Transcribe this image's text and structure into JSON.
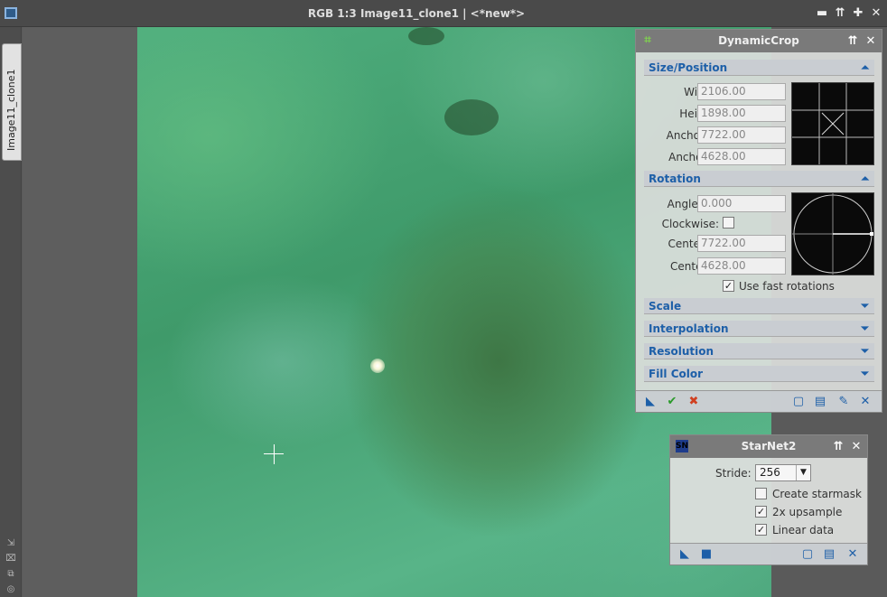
{
  "window": {
    "title": "RGB 1:3 Image11_clone1 | <*new*>",
    "buttons": [
      "▬",
      "⇈",
      "✚",
      "✕"
    ]
  },
  "side_tab": {
    "label": "Image11_clone1"
  },
  "side_icons": [
    "⇲",
    "⌧",
    "⧉",
    "◎"
  ],
  "dynamic_crop": {
    "title": "DynamicCrop",
    "size_position": {
      "header": "Size/Position",
      "fields": [
        {
          "label": "Width:",
          "value": "2106.00"
        },
        {
          "label": "Height:",
          "value": "1898.00"
        },
        {
          "label": "Anchor X:",
          "value": "7722.00"
        },
        {
          "label": "Anchor Y:",
          "value": "4628.00"
        }
      ]
    },
    "rotation": {
      "header": "Rotation",
      "angle_label": "Angle (°):",
      "angle_value": "0.000",
      "clockwise_label": "Clockwise:",
      "clockwise_checked": false,
      "center_x_label": "Center X:",
      "center_x_value": "7722.00",
      "center_y_label": "Center Y:",
      "center_y_value": "4628.00",
      "fast_label": "Use fast rotations",
      "fast_checked": true
    },
    "collapsed_sections": [
      "Scale",
      "Interpolation",
      "Resolution",
      "Fill Color"
    ]
  },
  "starnet": {
    "title": "StarNet2",
    "stride_label": "Stride:",
    "stride_value": "256",
    "options": [
      {
        "label": "Create starmask",
        "checked": false
      },
      {
        "label": "2x upsample",
        "checked": true
      },
      {
        "label": "Linear data",
        "checked": true
      }
    ]
  }
}
